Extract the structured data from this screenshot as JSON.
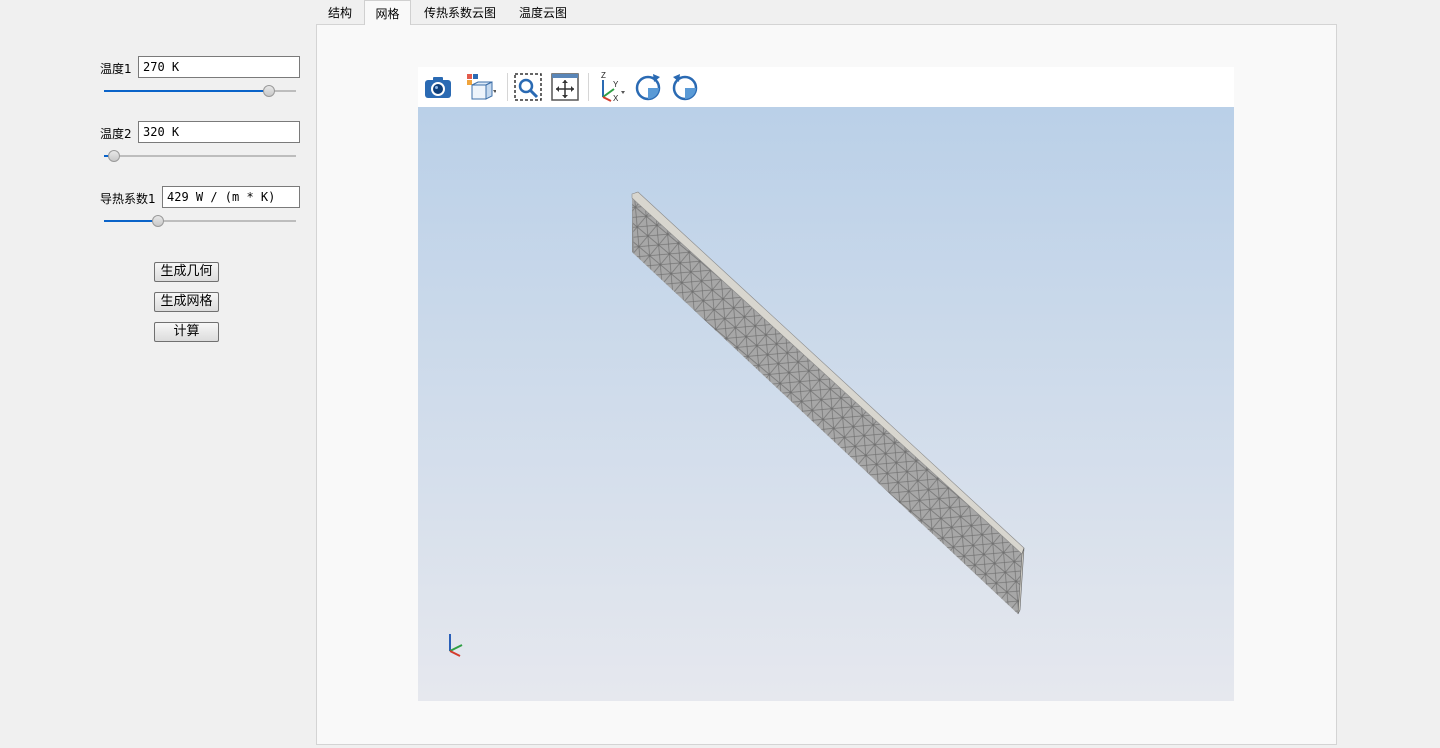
{
  "tabs": [
    {
      "label": "结构"
    },
    {
      "label": "网格"
    },
    {
      "label": "传热系数云图"
    },
    {
      "label": "温度云图"
    }
  ],
  "active_tab": "网格",
  "params": {
    "temp1": {
      "label": "温度1",
      "value": "270 K",
      "slider_fraction": 0.86
    },
    "temp2": {
      "label": "温度2",
      "value": "320 K",
      "slider_fraction": 0.05
    },
    "conductivity1": {
      "label": "导热系数1",
      "value": "429 W / (m * K)",
      "slider_fraction": 0.28
    }
  },
  "buttons": {
    "generate_geometry": "生成几何",
    "generate_mesh": "生成网格",
    "compute": "计算"
  },
  "viewer_toolbar": {
    "icons": [
      "camera-icon",
      "view-cube-icon",
      "zoom-box-icon",
      "fit-all-icon",
      "axis-orientation-icon",
      "rotate-cw-icon",
      "rotate-ccw-icon"
    ],
    "axis_labels": {
      "z": "Z",
      "y": "Y",
      "x": "X"
    }
  },
  "colors": {
    "accent": "#0a63c9",
    "viewport_top": "#bad0e8",
    "viewport_bottom": "#e6e8ee",
    "mesh_dark": "#6a6a6a",
    "mesh_light": "#d8d6cf"
  }
}
